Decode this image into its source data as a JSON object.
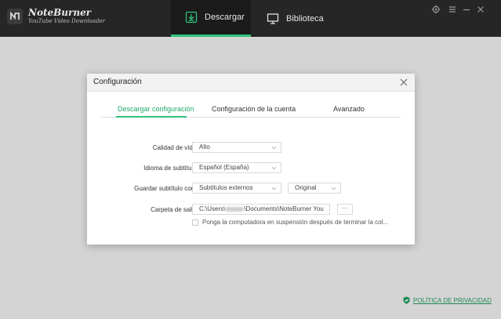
{
  "app": {
    "brand_name": "NoteBurner",
    "brand_subtitle": "YouTube Video Downloader"
  },
  "tabs": {
    "download_label": "Descargar",
    "library_label": "Biblioteca"
  },
  "modal": {
    "title": "Configuración",
    "subtabs": [
      "Descargar configuración",
      "Configuración de la cuenta",
      "Avanzado"
    ],
    "active_subtab": 0,
    "rows": {
      "quality": {
        "label": "Calidad de vídeo:",
        "value": "Alto"
      },
      "subtitle_lang": {
        "label": "Idioma de subtítulos:",
        "value": "Español (España)"
      },
      "subtitle_save": {
        "label": "Guardar subtítulo como:",
        "value": "Subtítulos externos",
        "value2": "Original"
      },
      "output": {
        "label": "Carpeta de salida:",
        "path_prefix": "C:\\Users\\",
        "path_suffix": "\\Documents\\NoteBurner You",
        "more_label": "···"
      },
      "sleep": {
        "label": "Ponga la computadora en suspensión después de terminar la col...",
        "checked": false
      }
    }
  },
  "footer": {
    "privacy_label": "POLÍTICA DE PRIVACIDAD"
  },
  "colors": {
    "accent": "#2fc27a",
    "titlebar": "#262626",
    "background": "#d4d4d4"
  },
  "icons": [
    "noteburner-logo-icon",
    "download-icon",
    "monitor-icon",
    "gear-icon",
    "menu-icon",
    "minimize-icon",
    "close-icon",
    "chevron-down-icon",
    "shield-check-icon"
  ]
}
